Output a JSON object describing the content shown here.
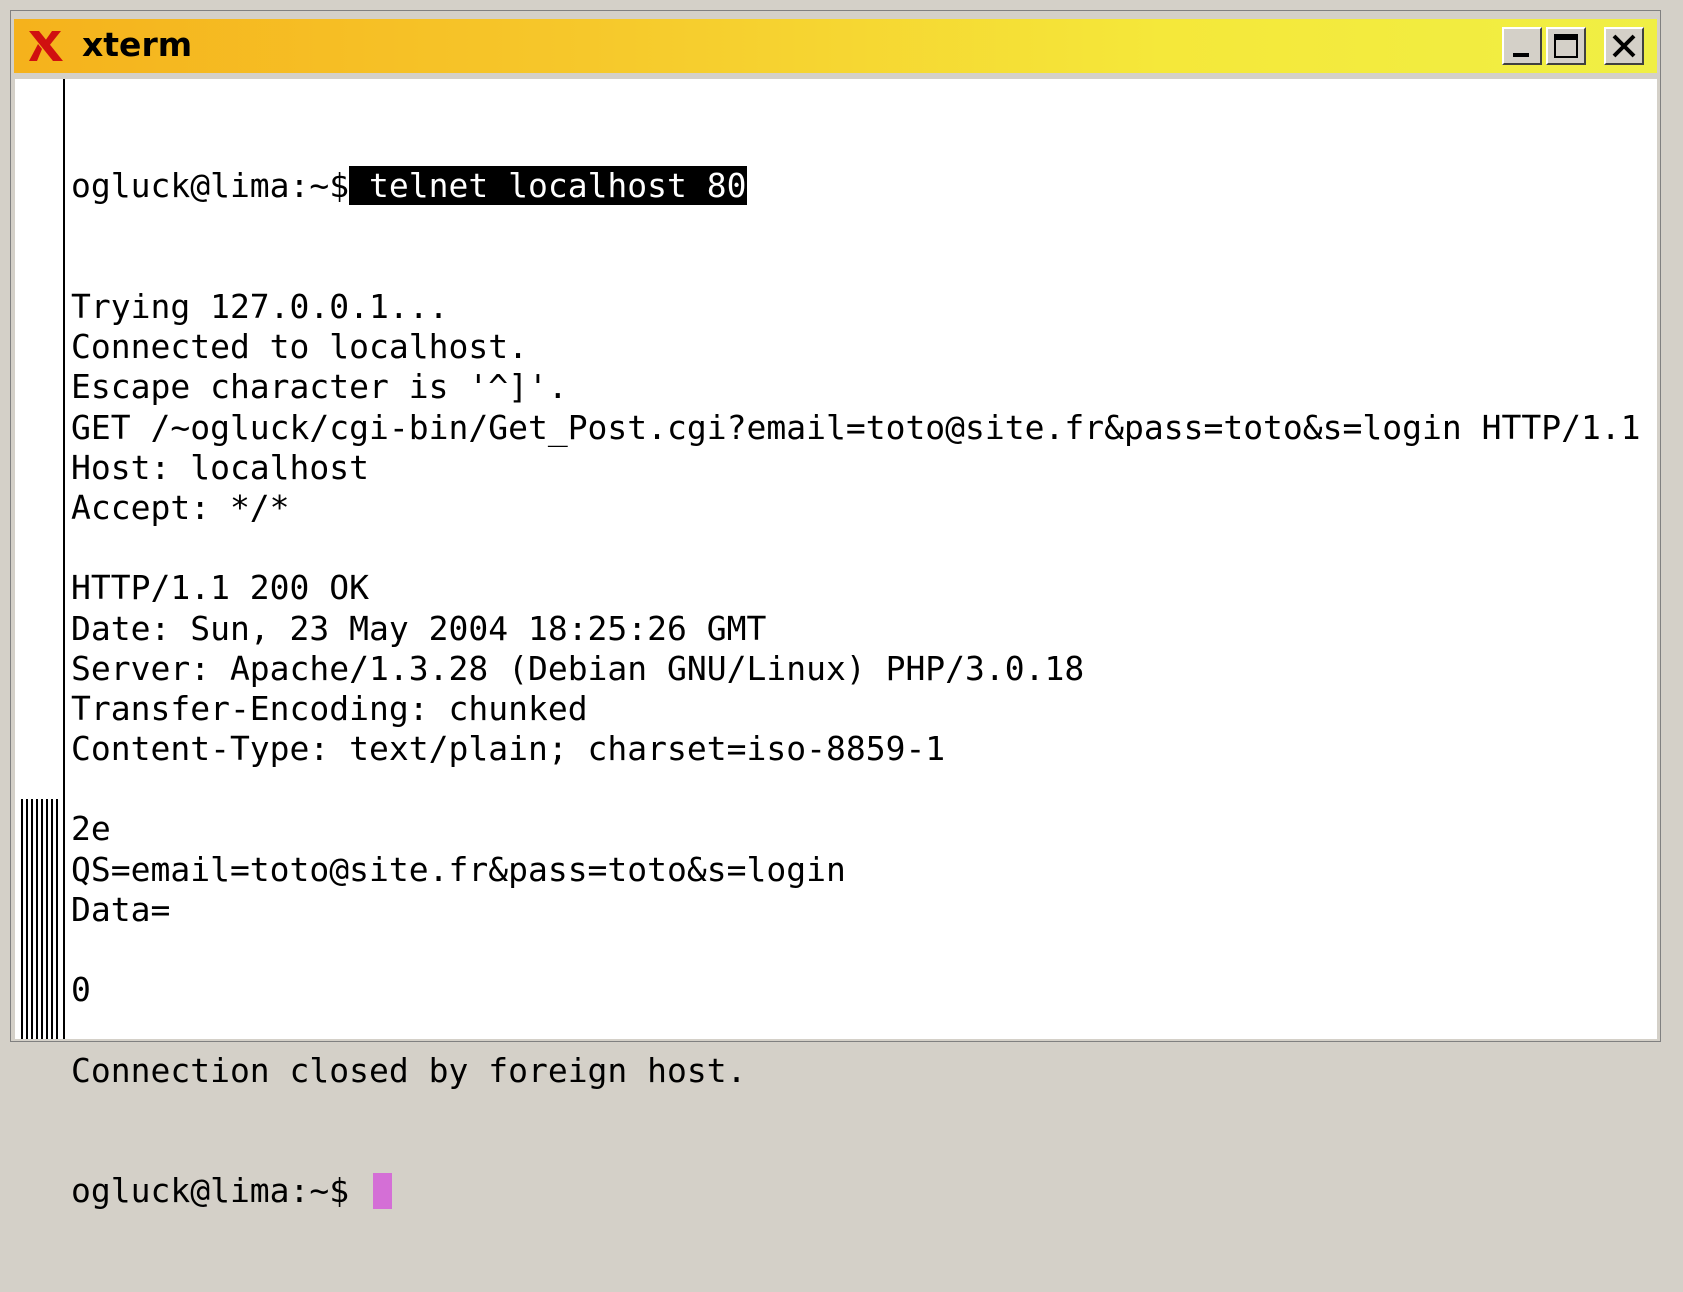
{
  "window": {
    "title": "xterm",
    "app_icon": "x-logo-icon",
    "accent_colors": {
      "titlebar_left": "#f5b21c",
      "titlebar_right": "#f0ef44",
      "app_icon": "#d01010",
      "cursor": "#d46fd6"
    },
    "buttons": {
      "minimize": "minimize-icon",
      "maximize": "maximize-icon",
      "close": "close-icon"
    }
  },
  "terminal": {
    "prompt": "ogluck@lima:~$",
    "command": " telnet localhost 80",
    "lines": [
      "Trying 127.0.0.1...",
      "Connected to localhost.",
      "Escape character is '^]'.",
      "GET /~ogluck/cgi-bin/Get_Post.cgi?email=toto@site.fr&pass=toto&s=login HTTP/1.1",
      "Host: localhost",
      "Accept: */*",
      "",
      "HTTP/1.1 200 OK",
      "Date: Sun, 23 May 2004 18:25:26 GMT",
      "Server: Apache/1.3.28 (Debian GNU/Linux) PHP/3.0.18",
      "Transfer-Encoding: chunked",
      "Content-Type: text/plain; charset=iso-8859-1",
      "",
      "2e",
      "QS=email=toto@site.fr&pass=toto&s=login",
      "Data=",
      "",
      "0",
      "",
      "Connection closed by foreign host."
    ],
    "final_prompt": "ogluck@lima:~$ "
  }
}
